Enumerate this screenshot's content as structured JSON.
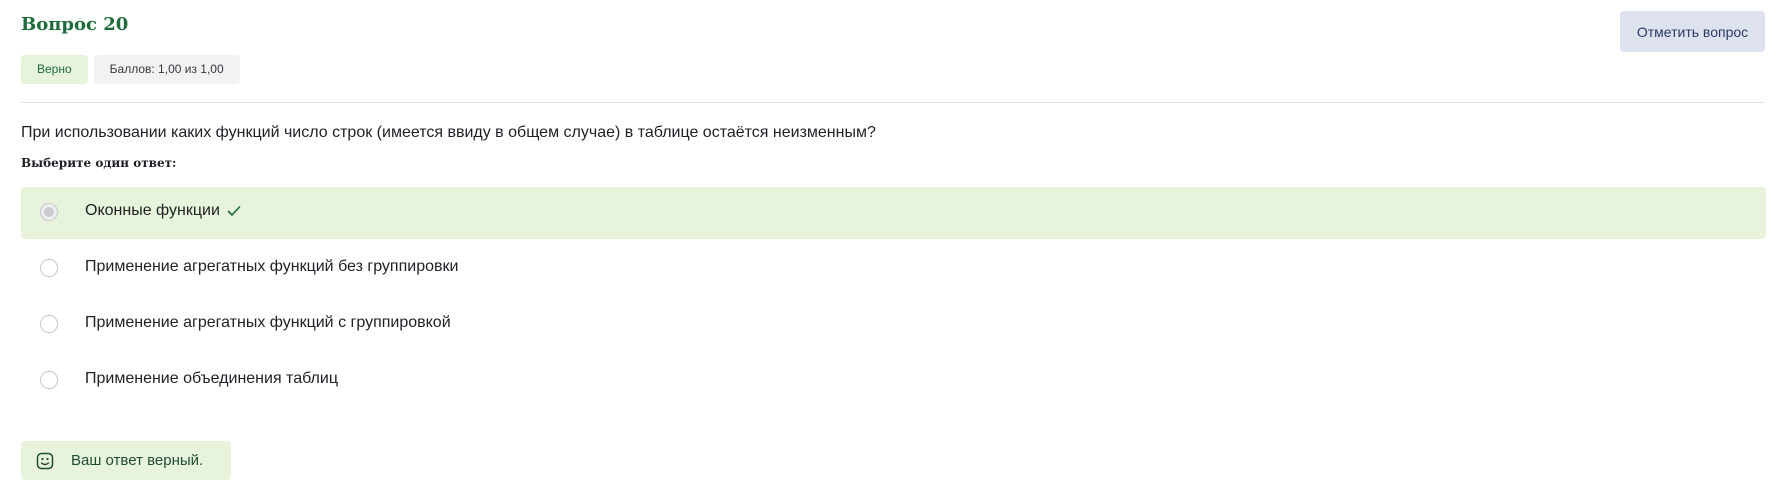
{
  "question": {
    "title": "Вопрос 20",
    "flag_label": "Отметить вопрос",
    "state_badge": "Верно",
    "grade_badge": "Баллов: 1,00 из 1,00",
    "text": "При использовании каких функций число строк (имеется ввиду в общем случае) в таблице остаётся неизменным?",
    "prompt": "Выберите один ответ:"
  },
  "answers": [
    {
      "label": "Оконные функции",
      "selected": true,
      "correct": true
    },
    {
      "label": "Применение агрегатных функций без группировки",
      "selected": false,
      "correct": false
    },
    {
      "label": "Применение агрегатных функций с группировкой",
      "selected": false,
      "correct": false
    },
    {
      "label": "Применение объединения таблиц",
      "selected": false,
      "correct": false
    }
  ],
  "feedback": {
    "text": "Ваш ответ верный.",
    "icon": "smile-icon"
  },
  "colors": {
    "accent_green": "#1e6b3c",
    "correct_bg": "#e8f3dc",
    "flag_bg": "#dee2ee"
  }
}
